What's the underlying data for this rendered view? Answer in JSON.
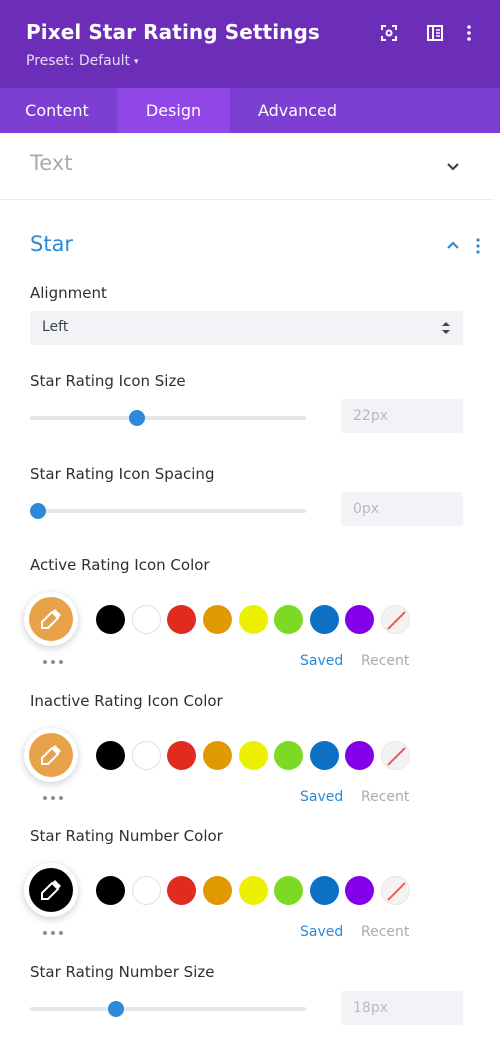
{
  "header": {
    "title": "Pixel Star Rating Settings",
    "preset_label": "Preset: Default",
    "preset_caret": "▾",
    "icons": [
      "focus-icon",
      "sidebar-icon",
      "more-vertical-icon"
    ]
  },
  "tabs": [
    {
      "label": "Content",
      "active": false
    },
    {
      "label": "Design",
      "active": true
    },
    {
      "label": "Advanced",
      "active": false
    }
  ],
  "sections": {
    "text": {
      "title": "Text",
      "expanded": false
    },
    "star": {
      "title": "Star",
      "expanded": true
    }
  },
  "alignment": {
    "label": "Alignment",
    "value": "Left"
  },
  "icon_size": {
    "label": "Star Rating Icon Size",
    "value": "22px",
    "slider_fraction": 0.38
  },
  "icon_spacing": {
    "label": "Star Rating Icon Spacing",
    "value": "0px",
    "slider_fraction": 0.0
  },
  "number_size": {
    "label": "Star Rating Number Size",
    "value": "18px",
    "slider_fraction": 0.3
  },
  "color_groups": [
    {
      "label": "Active Rating Icon Color",
      "selected": "#e8a24a",
      "saved_label": "Saved",
      "recent_label": "Recent"
    },
    {
      "label": "Inactive Rating Icon Color",
      "selected": "#e8a24a",
      "saved_label": "Saved",
      "recent_label": "Recent"
    },
    {
      "label": "Star Rating Number Color",
      "selected": "#000000",
      "saved_label": "Saved",
      "recent_label": "Recent"
    }
  ],
  "palette": [
    "#000000",
    "#ffffff",
    "#e02b20",
    "#e09900",
    "#edf000",
    "#7cda24",
    "#0c71c3",
    "#8300e9",
    "none"
  ],
  "colors": {
    "header": "#6c2eb9",
    "tabs": "#7c3fd1",
    "active_tab": "#9146e8",
    "accent": "#2c8ad8"
  }
}
